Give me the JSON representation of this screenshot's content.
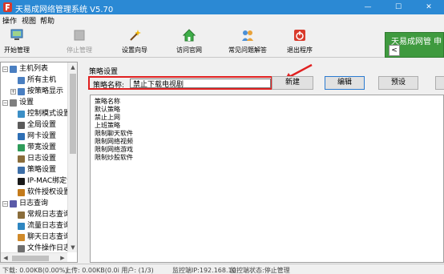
{
  "titlebar": {
    "title": "天易成网络管理系统 V5.70",
    "minimize_glyph": "—",
    "maximize_glyph": "☐",
    "close_glyph": "✕"
  },
  "menu": [
    "操作",
    "视图",
    "帮助"
  ],
  "toolbar": {
    "items": [
      {
        "label": "开始管理",
        "icon": "monitor-icon",
        "disabled": false
      },
      {
        "label": "停止管理",
        "icon": "stop-icon",
        "disabled": true
      },
      {
        "label": "设置向导",
        "icon": "wand-icon",
        "disabled": false
      },
      {
        "label": "访问官网",
        "icon": "home-icon",
        "disabled": false
      },
      {
        "label": "常见问题解答",
        "icon": "faq-icon",
        "disabled": false
      },
      {
        "label": "退出程序",
        "icon": "power-icon",
        "disabled": false
      }
    ]
  },
  "brand": {
    "text": "天易成网管 申",
    "nav_glyph": "<"
  },
  "sidebar": {
    "items": [
      {
        "label": "主机列表",
        "level": 0,
        "expander": "−",
        "icon": "computer-icon"
      },
      {
        "label": "所有主机",
        "level": 1,
        "expander": "",
        "icon": "computer-icon"
      },
      {
        "label": "按策略显示",
        "level": 1,
        "expander": "+",
        "icon": "computer-icon"
      },
      {
        "label": "设置",
        "level": 0,
        "expander": "−",
        "icon": "wrench-icon"
      },
      {
        "label": "控制模式设置",
        "level": 1,
        "expander": "",
        "icon": "control-icon"
      },
      {
        "label": "全局设置",
        "level": 1,
        "expander": "",
        "icon": "gear-icon"
      },
      {
        "label": "网卡设置",
        "level": 1,
        "expander": "",
        "icon": "nic-icon"
      },
      {
        "label": "带宽设置",
        "level": 1,
        "expander": "",
        "icon": "bandwidth-icon"
      },
      {
        "label": "日志设置",
        "level": 1,
        "expander": "",
        "icon": "log-icon"
      },
      {
        "label": "策略设置",
        "level": 1,
        "expander": "",
        "icon": "policy-icon"
      },
      {
        "label": "IP-MAC绑定设",
        "level": 1,
        "expander": "",
        "icon": "ipmac-icon"
      },
      {
        "label": "软件授权设置",
        "level": 1,
        "expander": "",
        "icon": "license-icon"
      },
      {
        "label": "日志查询",
        "level": 0,
        "expander": "−",
        "icon": "report-icon"
      },
      {
        "label": "常规日志查询",
        "level": 1,
        "expander": "",
        "icon": "log-icon"
      },
      {
        "label": "流量日志查询",
        "level": 1,
        "expander": "",
        "icon": "traffic-icon"
      },
      {
        "label": "聊天日志查询",
        "level": 1,
        "expander": "",
        "icon": "chat-icon"
      },
      {
        "label": "文件操作日志",
        "level": 1,
        "expander": "",
        "icon": "file-icon"
      }
    ]
  },
  "main": {
    "section_title": "策略设置",
    "name_label": "策略名称:",
    "name_value": "禁止下载电视剧",
    "buttons": [
      "新建",
      "编辑",
      "预设"
    ],
    "list": [
      "策略名称",
      "默认策略",
      "禁止上网",
      "上班策略",
      "限制聊天软件",
      "限制网络视频",
      "限制网络游戏",
      "限制炒股软件"
    ]
  },
  "colors": {
    "titlebar": "#2b89d4",
    "highlight": "#e02020",
    "brand": "#3f9a3f"
  },
  "status": {
    "download": "下载: 0.00KB(0.00%)",
    "upload": "上传: 0.00KB(0.0i 用户: (1/3)",
    "monitor_ip": "监控端IP:192.168.10",
    "monitor_state": "监控端状态:停止管理"
  }
}
